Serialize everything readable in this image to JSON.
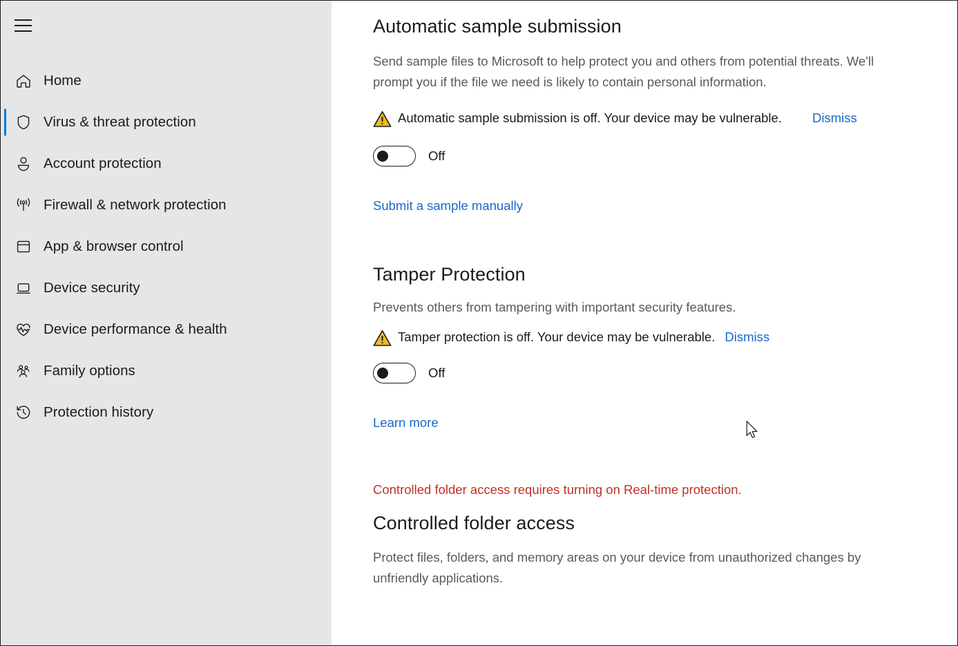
{
  "window": {
    "app": "Windows Security",
    "sidebar_bg": "#e6e6e6",
    "accent_color": "#0a79d6",
    "link_color": "#1668c8",
    "error_color": "#c32f27",
    "warning_color": "#f2b928"
  },
  "sidebar": {
    "menu_button_label": "Open Navigation",
    "items": [
      {
        "label": "Home",
        "icon": "home-icon",
        "selected": false
      },
      {
        "label": "Virus & threat protection",
        "icon": "shield-icon",
        "selected": true
      },
      {
        "label": "Account protection",
        "icon": "person-icon",
        "selected": false
      },
      {
        "label": "Firewall & network protection",
        "icon": "wifi-tower-icon",
        "selected": false
      },
      {
        "label": "App & browser control",
        "icon": "app-window-icon",
        "selected": false
      },
      {
        "label": "Device security",
        "icon": "laptop-icon",
        "selected": false
      },
      {
        "label": "Device performance & health",
        "icon": "heartbeat-icon",
        "selected": false
      },
      {
        "label": "Family options",
        "icon": "people-icon",
        "selected": false
      },
      {
        "label": "Protection history",
        "icon": "history-clock-icon",
        "selected": false
      }
    ]
  },
  "main": {
    "automatic_sample_submission": {
      "title": "Automatic sample submission",
      "description": "Send sample files to Microsoft to help protect you and others from potential threats. We'll prompt you if the file we need is likely to contain personal information.",
      "alert": {
        "icon": "warning-triangle-icon",
        "text": "Automatic sample submission is off. Your device may be vulnerable.",
        "dismiss_label": "Dismiss"
      },
      "toggle": {
        "state": "off",
        "label": "Off"
      },
      "link_label": "Submit a sample manually"
    },
    "tamper_protection": {
      "title": "Tamper Protection",
      "description": "Prevents others from tampering with important security features.",
      "alert": {
        "icon": "warning-triangle-icon",
        "text": "Tamper protection is off. Your device may be vulnerable.",
        "dismiss_label": "Dismiss"
      },
      "toggle": {
        "state": "off",
        "label": "Off"
      },
      "link_label": "Learn more"
    },
    "controlled_folder_access": {
      "error_text": "Controlled folder access requires turning on Real-time protection.",
      "title": "Controlled folder access",
      "description": "Protect files, folders, and memory areas on your device from unauthorized changes by unfriendly applications."
    }
  }
}
